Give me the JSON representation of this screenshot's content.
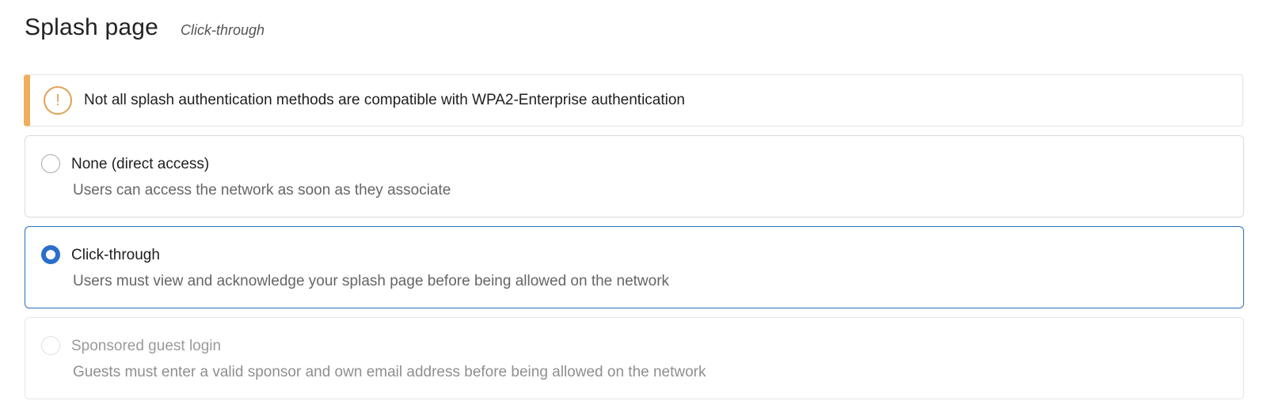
{
  "header": {
    "title": "Splash page",
    "subtitle": "Click-through"
  },
  "alert": {
    "icon": "warning-icon",
    "icon_glyph": "!",
    "message": "Not all splash authentication methods are compatible with WPA2-Enterprise authentication",
    "accent_color": "#f0ad5a"
  },
  "options": [
    {
      "label": "None (direct access)",
      "description": "Users can access the network as soon as they associate",
      "selected": false,
      "disabled": false
    },
    {
      "label": "Click-through",
      "description": "Users must view and acknowledge your splash page before being allowed on the network",
      "selected": true,
      "disabled": false
    },
    {
      "label": "Sponsored guest login",
      "description": "Guests must enter a valid sponsor and own email address before being allowed on the network",
      "selected": false,
      "disabled": true
    }
  ],
  "colors": {
    "selected_accent": "#2a6fc9"
  }
}
